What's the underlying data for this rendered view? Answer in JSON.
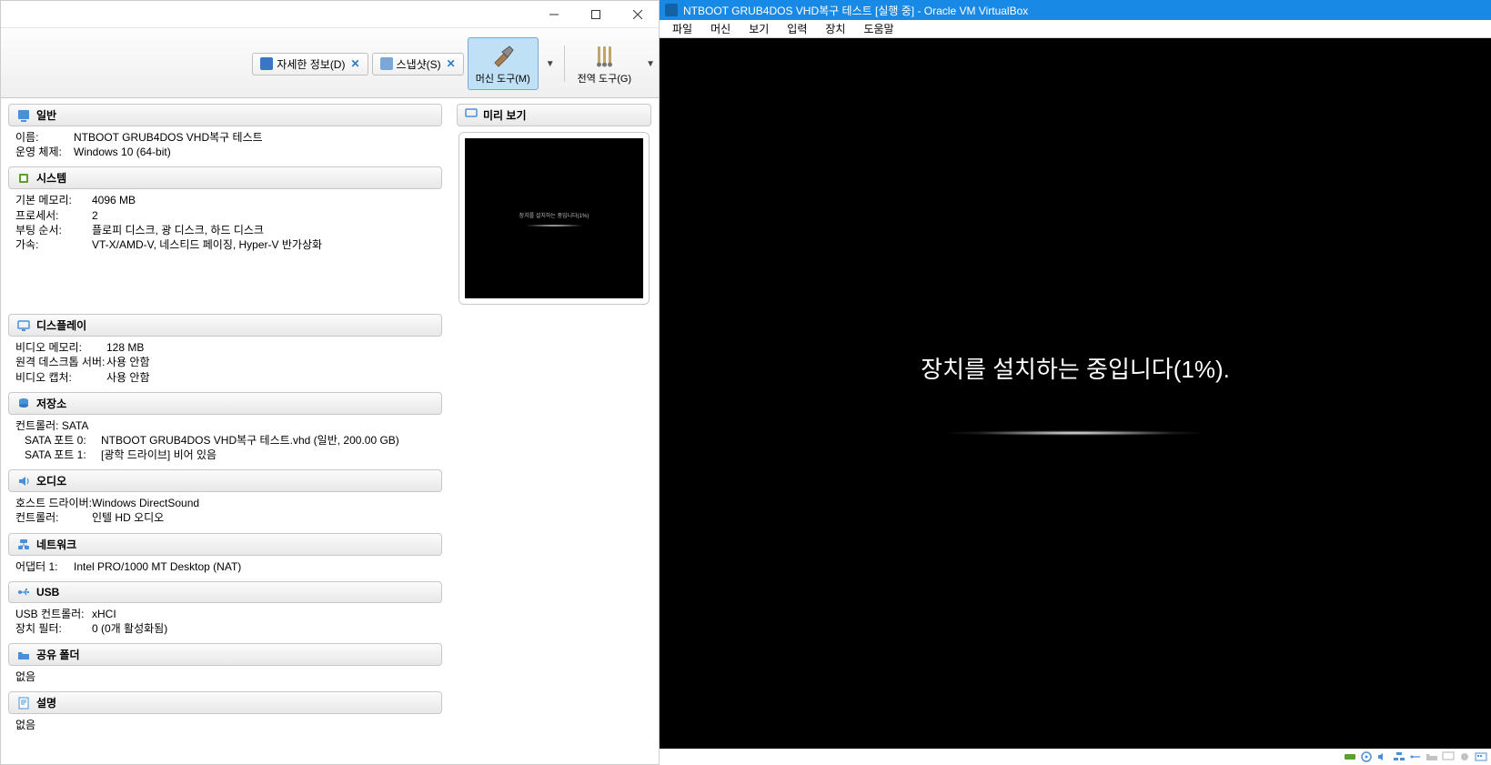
{
  "left": {
    "toolbar": {
      "details": "자세한 정보(D)",
      "snapshot": "스냅샷(S)",
      "machineTools": "머신 도구(M)",
      "globalTools": "전역 도구(G)"
    },
    "sections": {
      "general": {
        "title": "일반",
        "nameLabel": "이름:",
        "nameValue": "NTBOOT GRUB4DOS VHD복구 테스트",
        "osLabel": "운영 체제:",
        "osValue": "Windows 10 (64-bit)"
      },
      "system": {
        "title": "시스템",
        "memLabel": "기본 메모리:",
        "memValue": "4096 MB",
        "cpuLabel": "프로세서:",
        "cpuValue": "2",
        "bootLabel": "부팅 순서:",
        "bootValue": "플로피 디스크, 광 디스크, 하드 디스크",
        "accelLabel": "가속:",
        "accelValue": "VT-X/AMD-V, 네스티드 페이징, Hyper-V 반가상화"
      },
      "display": {
        "title": "디스플레이",
        "vmemLabel": "비디오 메모리:",
        "vmemValue": "128 MB",
        "rdpLabel": "원격 데스크톱 서버:",
        "rdpValue": "사용 안함",
        "capLabel": "비디오 캡처:",
        "capValue": "사용 안함"
      },
      "storage": {
        "title": "저장소",
        "controller": "컨트롤러: SATA",
        "port0Label": "SATA 포트 0:",
        "port0Value": "NTBOOT GRUB4DOS VHD복구 테스트.vhd (일반, 200.00 GB)",
        "port1Label": "SATA 포트 1:",
        "port1Value": "[광학 드라이브] 비어 있음"
      },
      "audio": {
        "title": "오디오",
        "hostLabel": "호스트 드라이버:",
        "hostValue": "Windows DirectSound",
        "ctrlLabel": "컨트롤러:",
        "ctrlValue": "인텔 HD 오디오"
      },
      "network": {
        "title": "네트워크",
        "adapterLabel": "어댑터 1:",
        "adapterValue": "Intel PRO/1000 MT Desktop (NAT)"
      },
      "usb": {
        "title": "USB",
        "ctrlLabel": "USB 컨트롤러:",
        "ctrlValue": "xHCI",
        "filterLabel": "장치 필터:",
        "filterValue": "0 (0개 활성화됨)"
      },
      "shared": {
        "title": "공유 폴더",
        "value": "없음"
      },
      "desc": {
        "title": "설명",
        "value": "없음"
      }
    },
    "preview": {
      "title": "미리 보기",
      "text": "장치를 설치하는 중입니다(1%)"
    }
  },
  "right": {
    "title": "NTBOOT GRUB4DOS VHD복구 테스트 [실행 중] - Oracle VM VirtualBox",
    "menu": {
      "file": "파일",
      "machine": "머신",
      "view": "보기",
      "input": "입력",
      "device": "장치",
      "help": "도움말"
    },
    "screenText": "장치를 설치하는 중입니다(1%)."
  }
}
